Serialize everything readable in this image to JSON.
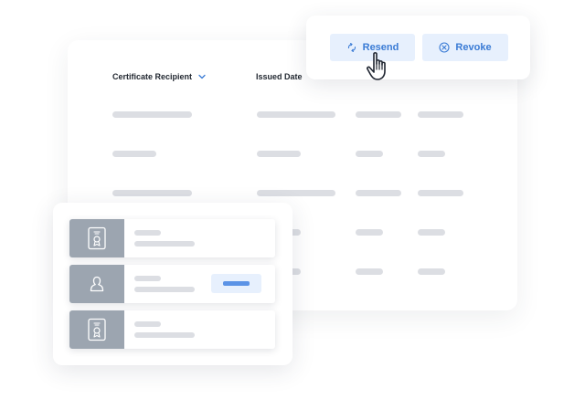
{
  "table": {
    "headers": [
      {
        "label": "Certificate Recipient",
        "icon": "chevron-down-icon"
      },
      {
        "label": "Issued Date",
        "icon": "chevron-down-icon"
      }
    ],
    "row_count": 5
  },
  "actions": {
    "resend_label": "Resend",
    "resend_icon": "refresh-icon",
    "revoke_label": "Revoke",
    "revoke_icon": "circle-x-icon",
    "cursor_icon": "hand-pointer-icon"
  },
  "list": {
    "items": [
      {
        "icon": "certificate-icon",
        "has_tag": false
      },
      {
        "icon": "user-icon",
        "has_tag": true
      },
      {
        "icon": "certificate-icon",
        "has_tag": false
      }
    ]
  },
  "colors": {
    "accent": "#3a7bd5",
    "accent_bg": "#e7f0fd",
    "placeholder": "#dcdee3",
    "thumb": "#9ca5b0",
    "tag_bar": "#5b93e6"
  }
}
